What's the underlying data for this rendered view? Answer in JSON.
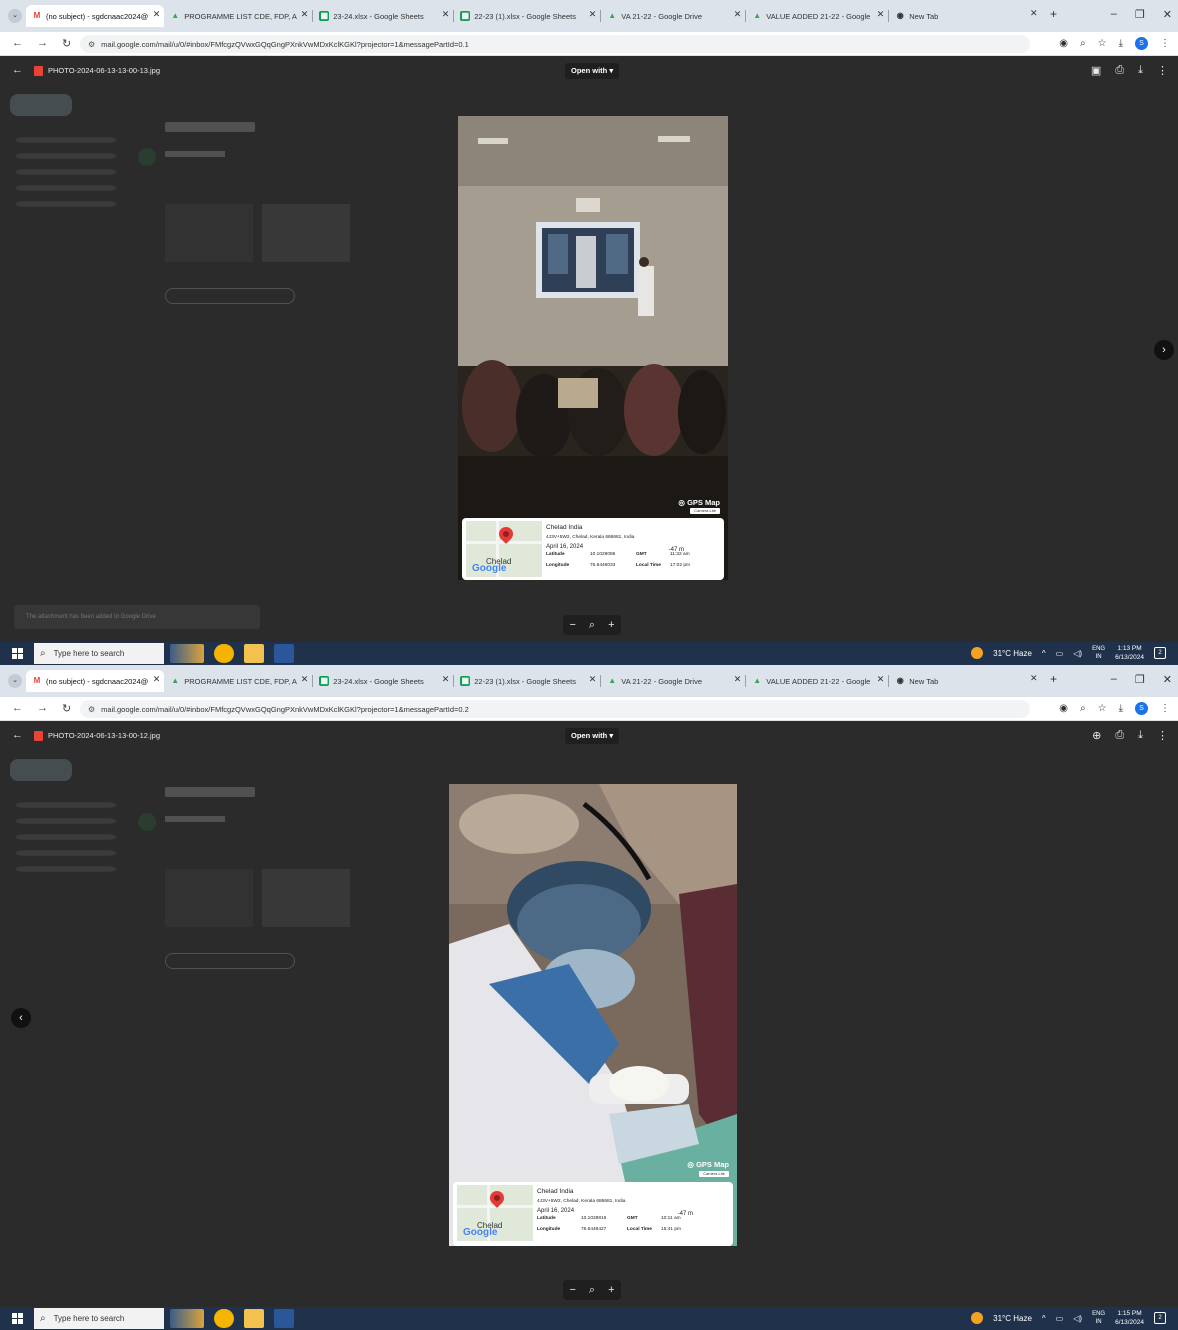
{
  "screens": [
    {
      "browser": {
        "tabs": [
          {
            "title": "(no subject) - sgdcnaac2024@",
            "icon": "gmail-icon",
            "active": true
          },
          {
            "title": "PROGRAMME LIST CDE, FDP, A",
            "icon": "drive-icon"
          },
          {
            "title": "23-24.xlsx - Google Sheets",
            "icon": "sheets-icon"
          },
          {
            "title": "22-23 (1).xlsx - Google Sheets",
            "icon": "sheets-icon"
          },
          {
            "title": "VA 21-22 - Google Drive",
            "icon": "drive-icon"
          },
          {
            "title": "VALUE ADDED 21-22 - Google",
            "icon": "drive-icon"
          },
          {
            "title": "New Tab",
            "icon": "chrome-icon"
          }
        ],
        "url": "mail.google.com/mail/u/0/#inbox/FMfcgzQVwxGQqGngPXnkVwMDxKclKGKl?projector=1&messagePartId=0.1"
      },
      "viewer": {
        "file_name": "PHOTO-2024-06-13-13-00-13.jpg",
        "open_with": "Open with",
        "toast": "The attachment has been added to Google Drive",
        "gps": {
          "brand": "GPS Map",
          "sub_brand": "Camera Lite",
          "place": "Chelad India",
          "address": "4J3V+5W2, Chelad, Kerala 686681, India",
          "date": "April 16, 2024",
          "altitude": "-47 m",
          "map_town": "Chelad",
          "lat_label": "Latitude",
          "lat_value": "10.1029086",
          "gmt_label": "GMT",
          "gmt_value": "11:32 am",
          "lon_label": "Longitude",
          "lon_value": "76.6448033",
          "local_label": "Local Time",
          "local_value": "17:02 pm"
        }
      },
      "taskbar": {
        "search_placeholder": "Type here to search",
        "weather": "31°C Haze",
        "lang_top": "ENG",
        "lang_bottom": "IN",
        "time": "1:13 PM",
        "date": "6/13/2024",
        "notif_count": "2"
      }
    },
    {
      "browser": {
        "tabs": [
          {
            "title": "(no subject) - sgdcnaac2024@",
            "icon": "gmail-icon",
            "active": true
          },
          {
            "title": "PROGRAMME LIST CDE, FDP, A",
            "icon": "drive-icon"
          },
          {
            "title": "23-24.xlsx - Google Sheets",
            "icon": "sheets-icon"
          },
          {
            "title": "22-23 (1).xlsx - Google Sheets",
            "icon": "sheets-icon"
          },
          {
            "title": "VA 21-22 - Google Drive",
            "icon": "drive-icon"
          },
          {
            "title": "VALUE ADDED 21-22 - Google",
            "icon": "drive-icon"
          },
          {
            "title": "New Tab",
            "icon": "chrome-icon"
          }
        ],
        "url": "mail.google.com/mail/u/0/#inbox/FMfcgzQVwxGQqGngPXnkVwMDxKclKGKl?projector=1&messagePartId=0.2"
      },
      "viewer": {
        "file_name": "PHOTO-2024-06-13-13-00-12.jpg",
        "open_with": "Open with",
        "gps": {
          "brand": "GPS Map",
          "sub_brand": "Camera Lite",
          "place": "Chelad India",
          "address": "4J3V+5W2, Chelad, Kerala 686681, India",
          "date": "April 16, 2024",
          "altitude": "-47 m",
          "map_town": "Chelad",
          "lat_label": "Latitude",
          "lat_value": "10.1028816",
          "gmt_label": "GMT",
          "gmt_value": "10:11 am",
          "lon_label": "Longitude",
          "lon_value": "76.6448427",
          "local_label": "Local Time",
          "local_value": "15:41 pm"
        }
      },
      "taskbar": {
        "search_placeholder": "Type here to search",
        "weather": "31°C Haze",
        "lang_top": "ENG",
        "lang_bottom": "IN",
        "time": "1:15 PM",
        "date": "6/13/2024",
        "notif_count": "2"
      }
    }
  ],
  "colors": {
    "tab_strip": "#dde3ea",
    "viewer_bg": "#2b2b2b",
    "taskbar": "#20324b",
    "pin_red": "#e53935",
    "brand_blue": "#1a73e8"
  }
}
